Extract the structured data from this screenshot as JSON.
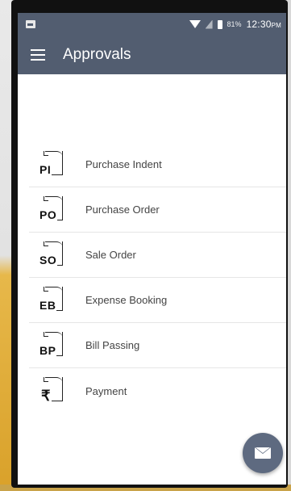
{
  "status_bar": {
    "battery_percent": "81%",
    "time": "12:30",
    "meridiem": "PM"
  },
  "app_bar": {
    "title": "Approvals"
  },
  "approvals": [
    {
      "abbr": "PI",
      "label": "Purchase Indent"
    },
    {
      "abbr": "PO",
      "label": "Purchase Order"
    },
    {
      "abbr": "SO",
      "label": "Sale Order"
    },
    {
      "abbr": "EB",
      "label": "Expense Booking"
    },
    {
      "abbr": "BP",
      "label": "Bill Passing"
    },
    {
      "abbr": "₹",
      "label": "Payment"
    }
  ],
  "colors": {
    "app_bar": "#525d70",
    "fab": "#5e6a80"
  },
  "icons": {
    "menu": "hamburger-menu-icon",
    "fab": "mail-icon"
  }
}
